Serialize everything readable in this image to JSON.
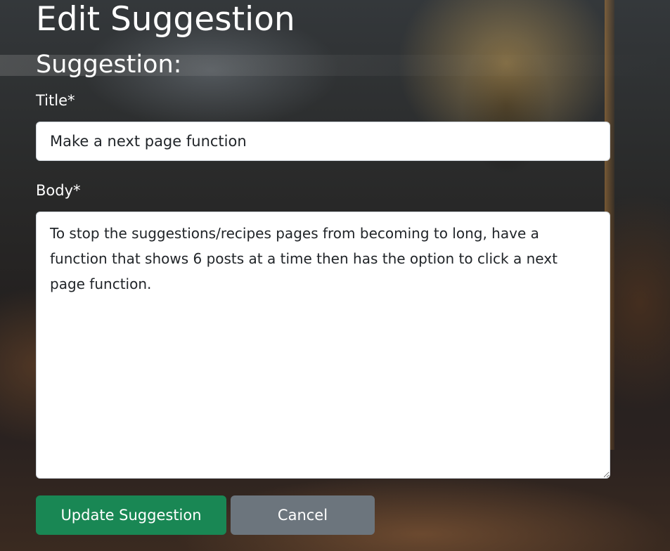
{
  "page": {
    "title": "Edit Suggestion",
    "section_heading": "Suggestion:"
  },
  "form": {
    "title_label": "Title*",
    "title_value": "Make a next page function",
    "body_label": "Body*",
    "body_value": "To stop the suggestions/recipes pages from becoming to long, have a function that shows 6 posts at a time then has the option to click a next page function."
  },
  "buttons": {
    "update_label": "Update Suggestion",
    "cancel_label": "Cancel"
  },
  "colors": {
    "update_button": "#198754",
    "cancel_button": "#6c757d",
    "heading_text": "#ffffff"
  }
}
